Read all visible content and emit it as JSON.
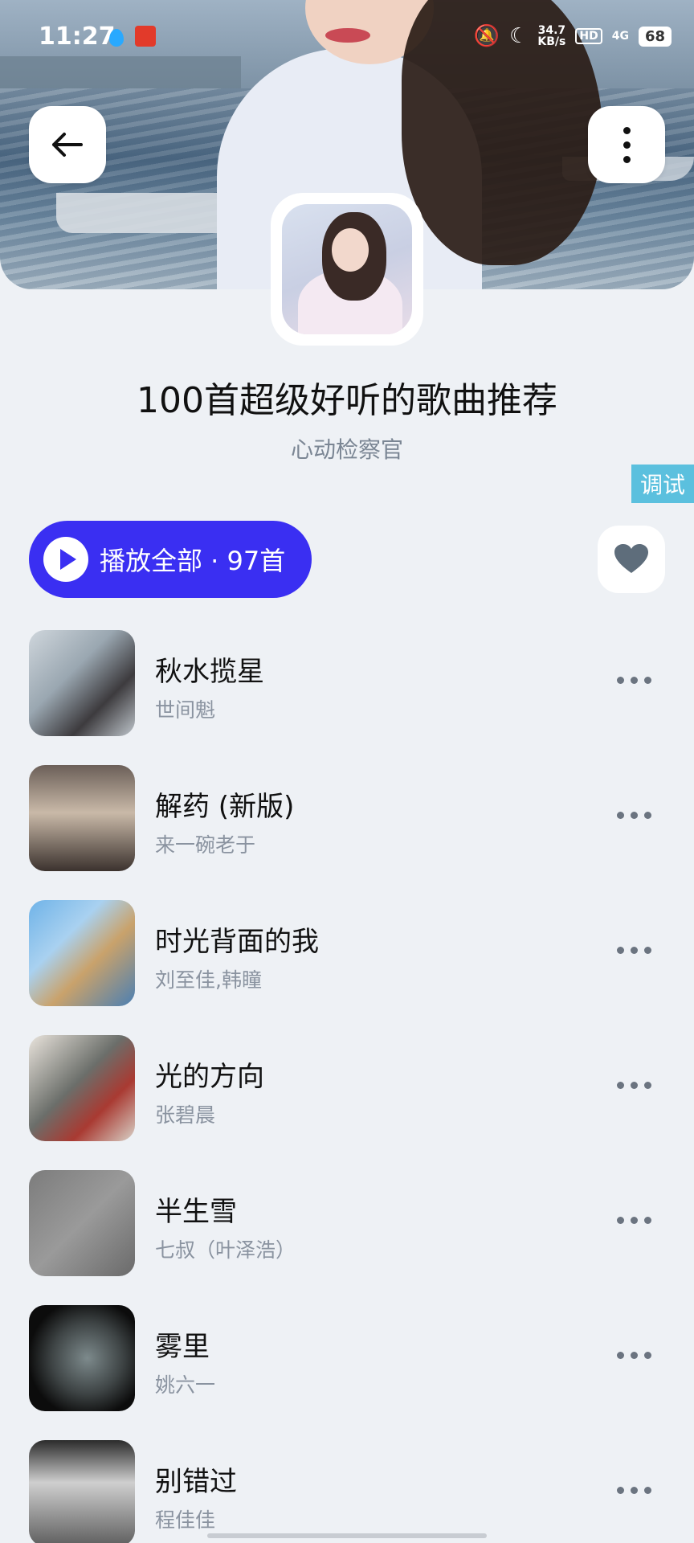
{
  "status_bar": {
    "time": "11:27",
    "net_speed_value": "34.7",
    "net_speed_unit": "KB/s",
    "hd_label": "HD",
    "network_label": "4G",
    "battery": "68"
  },
  "playlist": {
    "title": "100首超级好听的歌曲推荐",
    "creator": "心动检察官",
    "play_all_label": "播放全部 · 97首"
  },
  "debug_label": "调试",
  "songs": [
    {
      "title": "秋水揽星",
      "artist": "世间魁"
    },
    {
      "title": "解药 (新版)",
      "artist": "来一碗老于"
    },
    {
      "title": "时光背面的我",
      "artist": "刘至佳,韩瞳"
    },
    {
      "title": "光的方向",
      "artist": "张碧晨"
    },
    {
      "title": "半生雪",
      "artist": "七叔（叶泽浩）"
    },
    {
      "title": "雾里",
      "artist": "姚六一"
    },
    {
      "title": "别错过",
      "artist": "程佳佳"
    }
  ],
  "colors": {
    "accent": "#3a2ff2",
    "background": "#eef1f5",
    "secondary_text": "#7b8694"
  },
  "icons": {
    "back": "arrow-left-icon",
    "more": "vertical-dots-icon",
    "favorite": "heart-icon",
    "play": "play-icon",
    "song_more": "horizontal-dots-icon"
  }
}
